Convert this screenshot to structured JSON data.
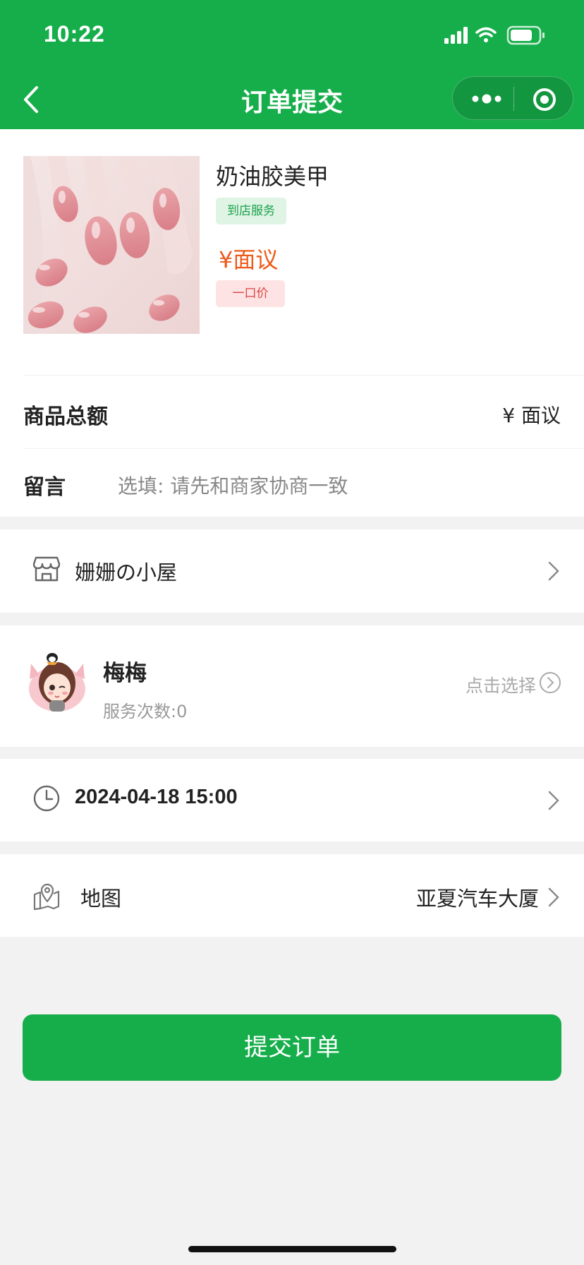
{
  "status_bar": {
    "time": "10:22"
  },
  "nav": {
    "title": "订单提交"
  },
  "product": {
    "name": "奶油胶美甲",
    "service_tag": "到店服务",
    "price": "¥面议",
    "price_tag": "一口价"
  },
  "total": {
    "label": "商品总额",
    "value": "¥ 面议"
  },
  "message": {
    "label": "留言",
    "placeholder": "选填: 请先和商家协商一致"
  },
  "shop": {
    "name": "姗姗の小屋"
  },
  "staff": {
    "name": "梅梅",
    "service_count": "服务次数:0",
    "select_label": "点击选择"
  },
  "appointment": {
    "datetime": "2024-04-18 15:00"
  },
  "location": {
    "label": "地图",
    "address": "亚夏汽车大厦"
  },
  "submit": {
    "label": "提交订单"
  },
  "colors": {
    "brand_green": "#16ae4a",
    "price_orange": "#ee5a1a"
  }
}
